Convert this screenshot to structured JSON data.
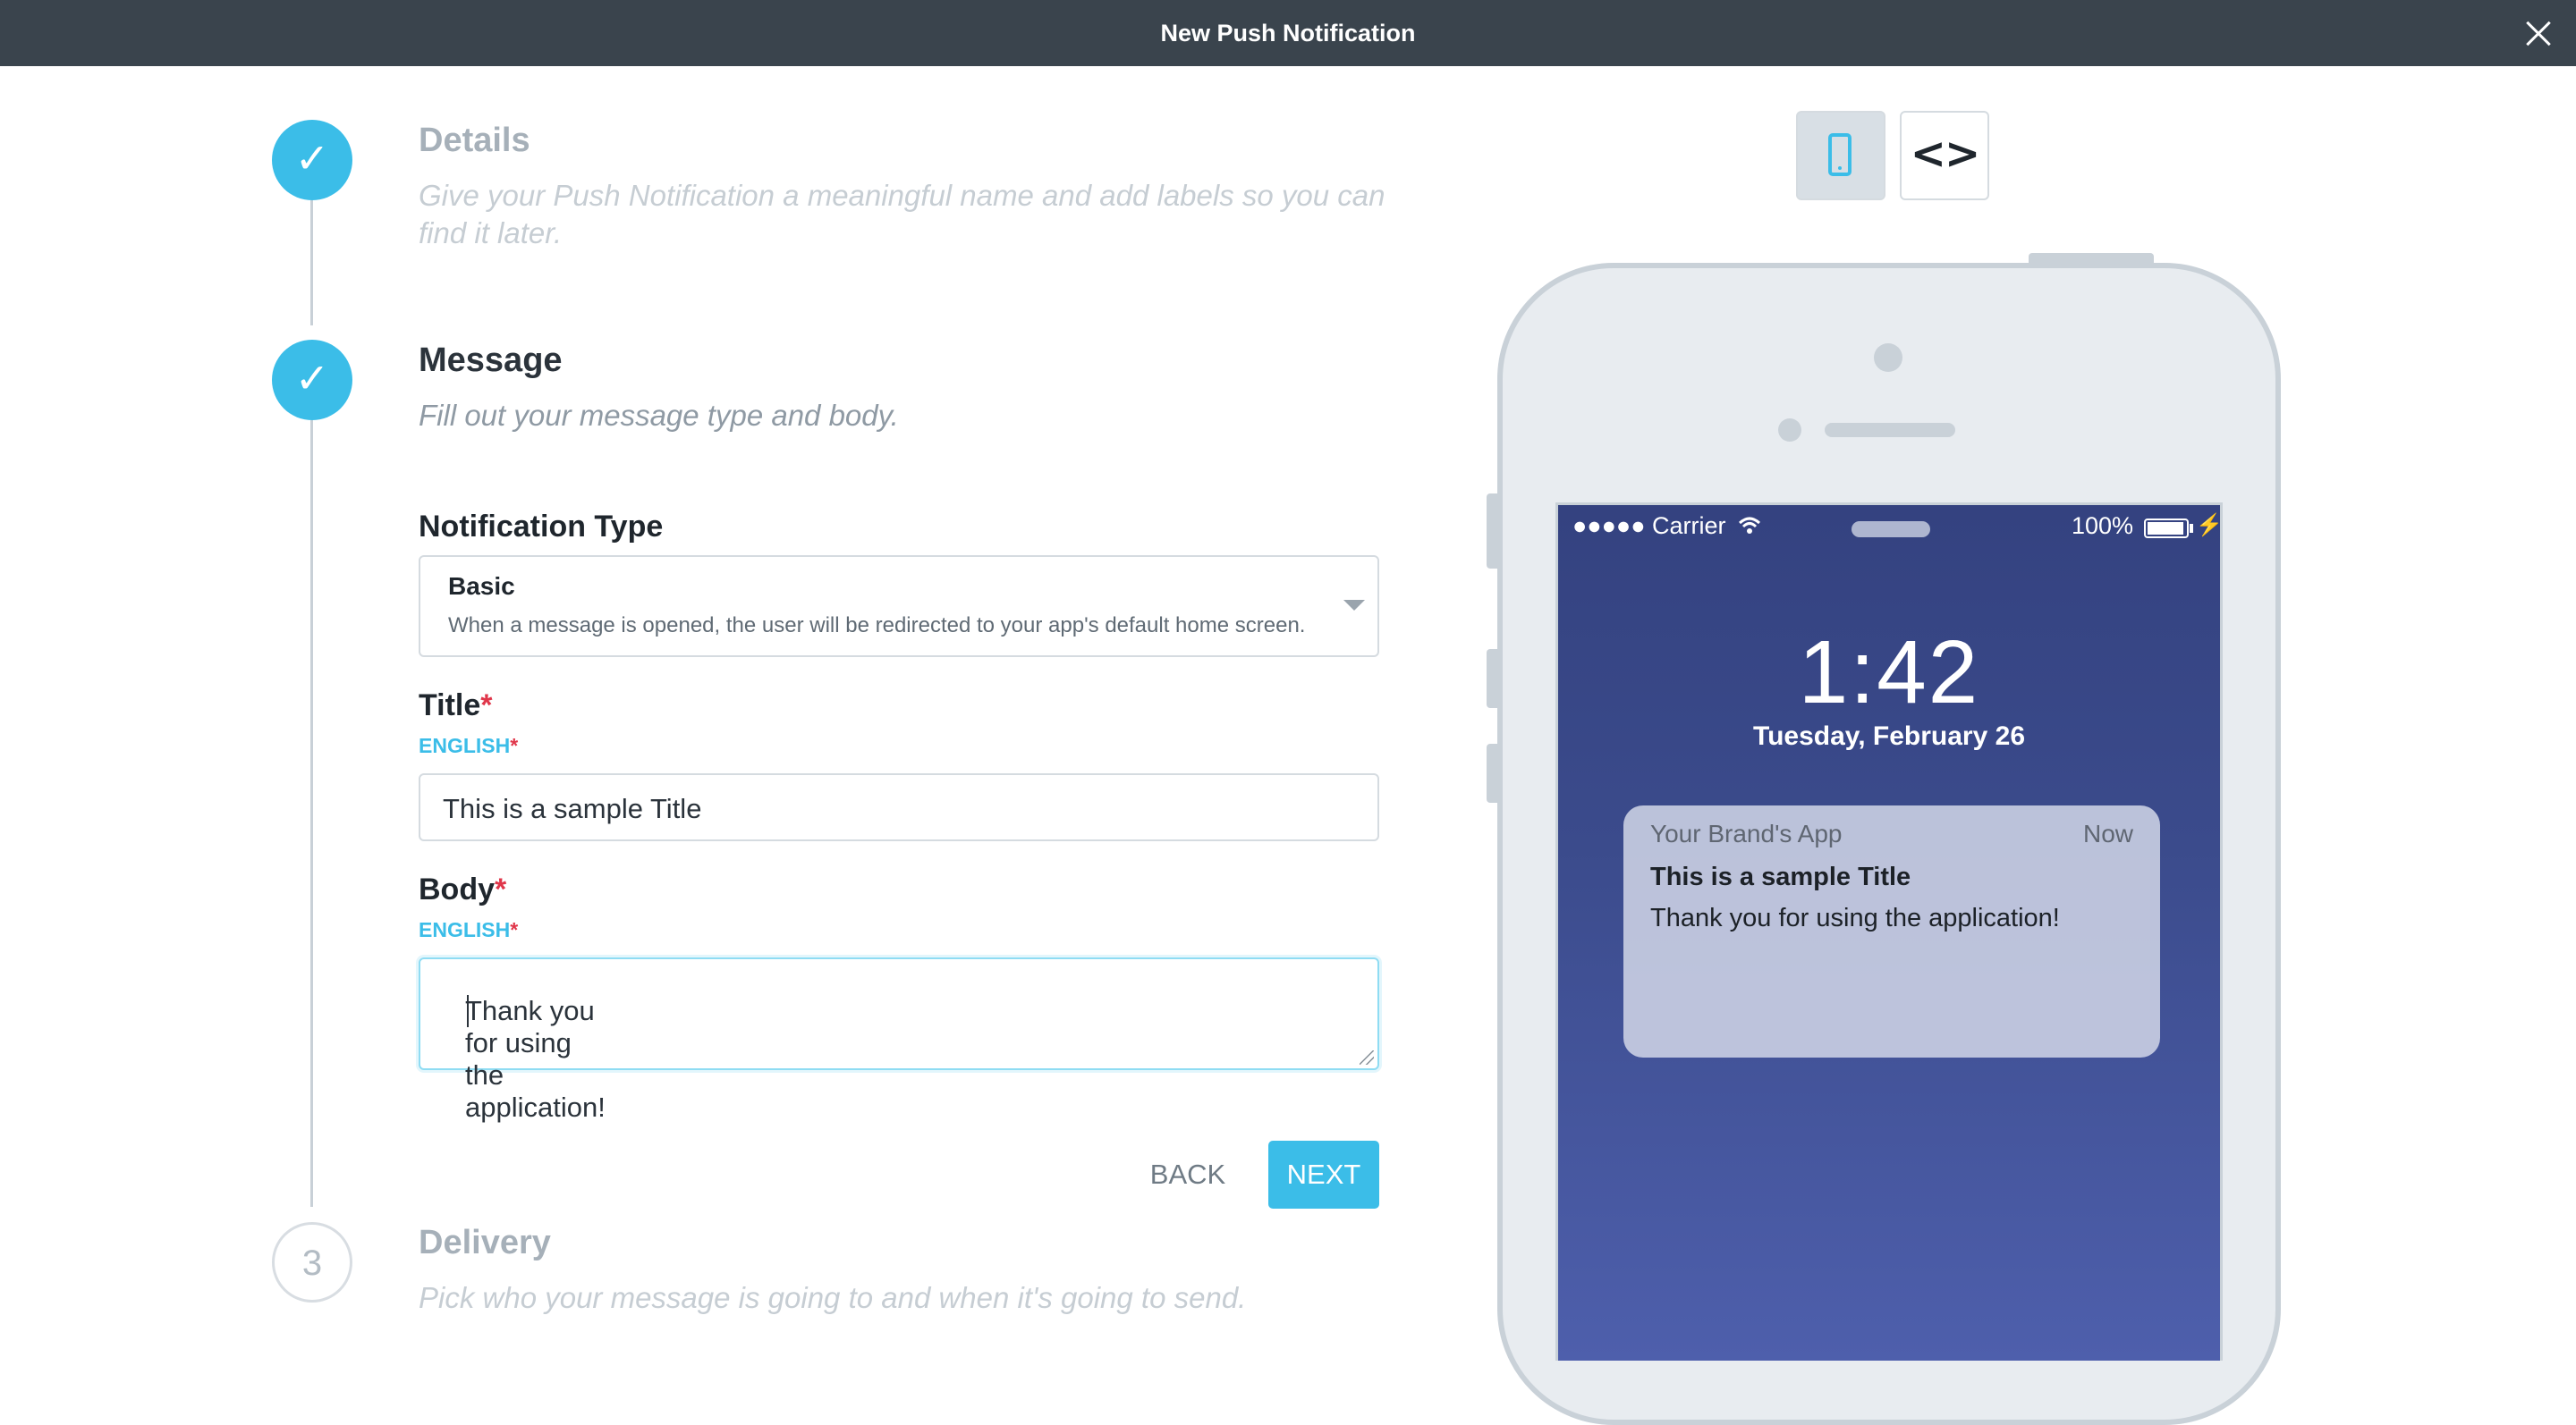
{
  "header": {
    "title": "New Push Notification",
    "close_icon": "close-icon"
  },
  "steps": [
    {
      "state": "done",
      "icon": "check-icon",
      "glyph": "✓",
      "title": "Details",
      "description": "Give your Push Notification a meaningful name and add labels so you can find it later."
    },
    {
      "state": "done",
      "icon": "check-icon",
      "glyph": "✓",
      "title": "Message",
      "description": "Fill out your message type and body."
    },
    {
      "state": "pending",
      "number": "3",
      "title": "Delivery",
      "description": "Pick who your message is going to and when it's going to send."
    }
  ],
  "form": {
    "notification_type": {
      "label": "Notification Type",
      "selected": "Basic",
      "help": "When a message is opened, the user will be redirected to your app's default home screen."
    },
    "title": {
      "label": "Title",
      "required_mark": "*",
      "language": "ENGLISH",
      "value": "This is a sample Title"
    },
    "body": {
      "label": "Body",
      "required_mark": "*",
      "language": "ENGLISH",
      "value": "Thank you for using the application!"
    },
    "back_label": "BACK",
    "next_label": "NEXT"
  },
  "preview": {
    "toggles": [
      {
        "name": "mobile-preview",
        "icon": "phone-icon",
        "active": true
      },
      {
        "name": "code-preview",
        "icon": "code-icon",
        "glyph": "<>",
        "active": false
      }
    ],
    "status_bar": {
      "signal": "●●●●● Carrier",
      "battery": "100%",
      "bolt": "⚡"
    },
    "lock_screen": {
      "time": "1:42",
      "date": "Tuesday, February 26"
    },
    "notification": {
      "app_name": "Your Brand's App",
      "time": "Now",
      "title": "This is a sample Title",
      "body": "Thank you for using the application!"
    }
  },
  "colors": {
    "accent": "#3bbde8",
    "topbar": "#3a444d",
    "required": "#e0364a",
    "lock_screen": "#3b4b8c"
  }
}
